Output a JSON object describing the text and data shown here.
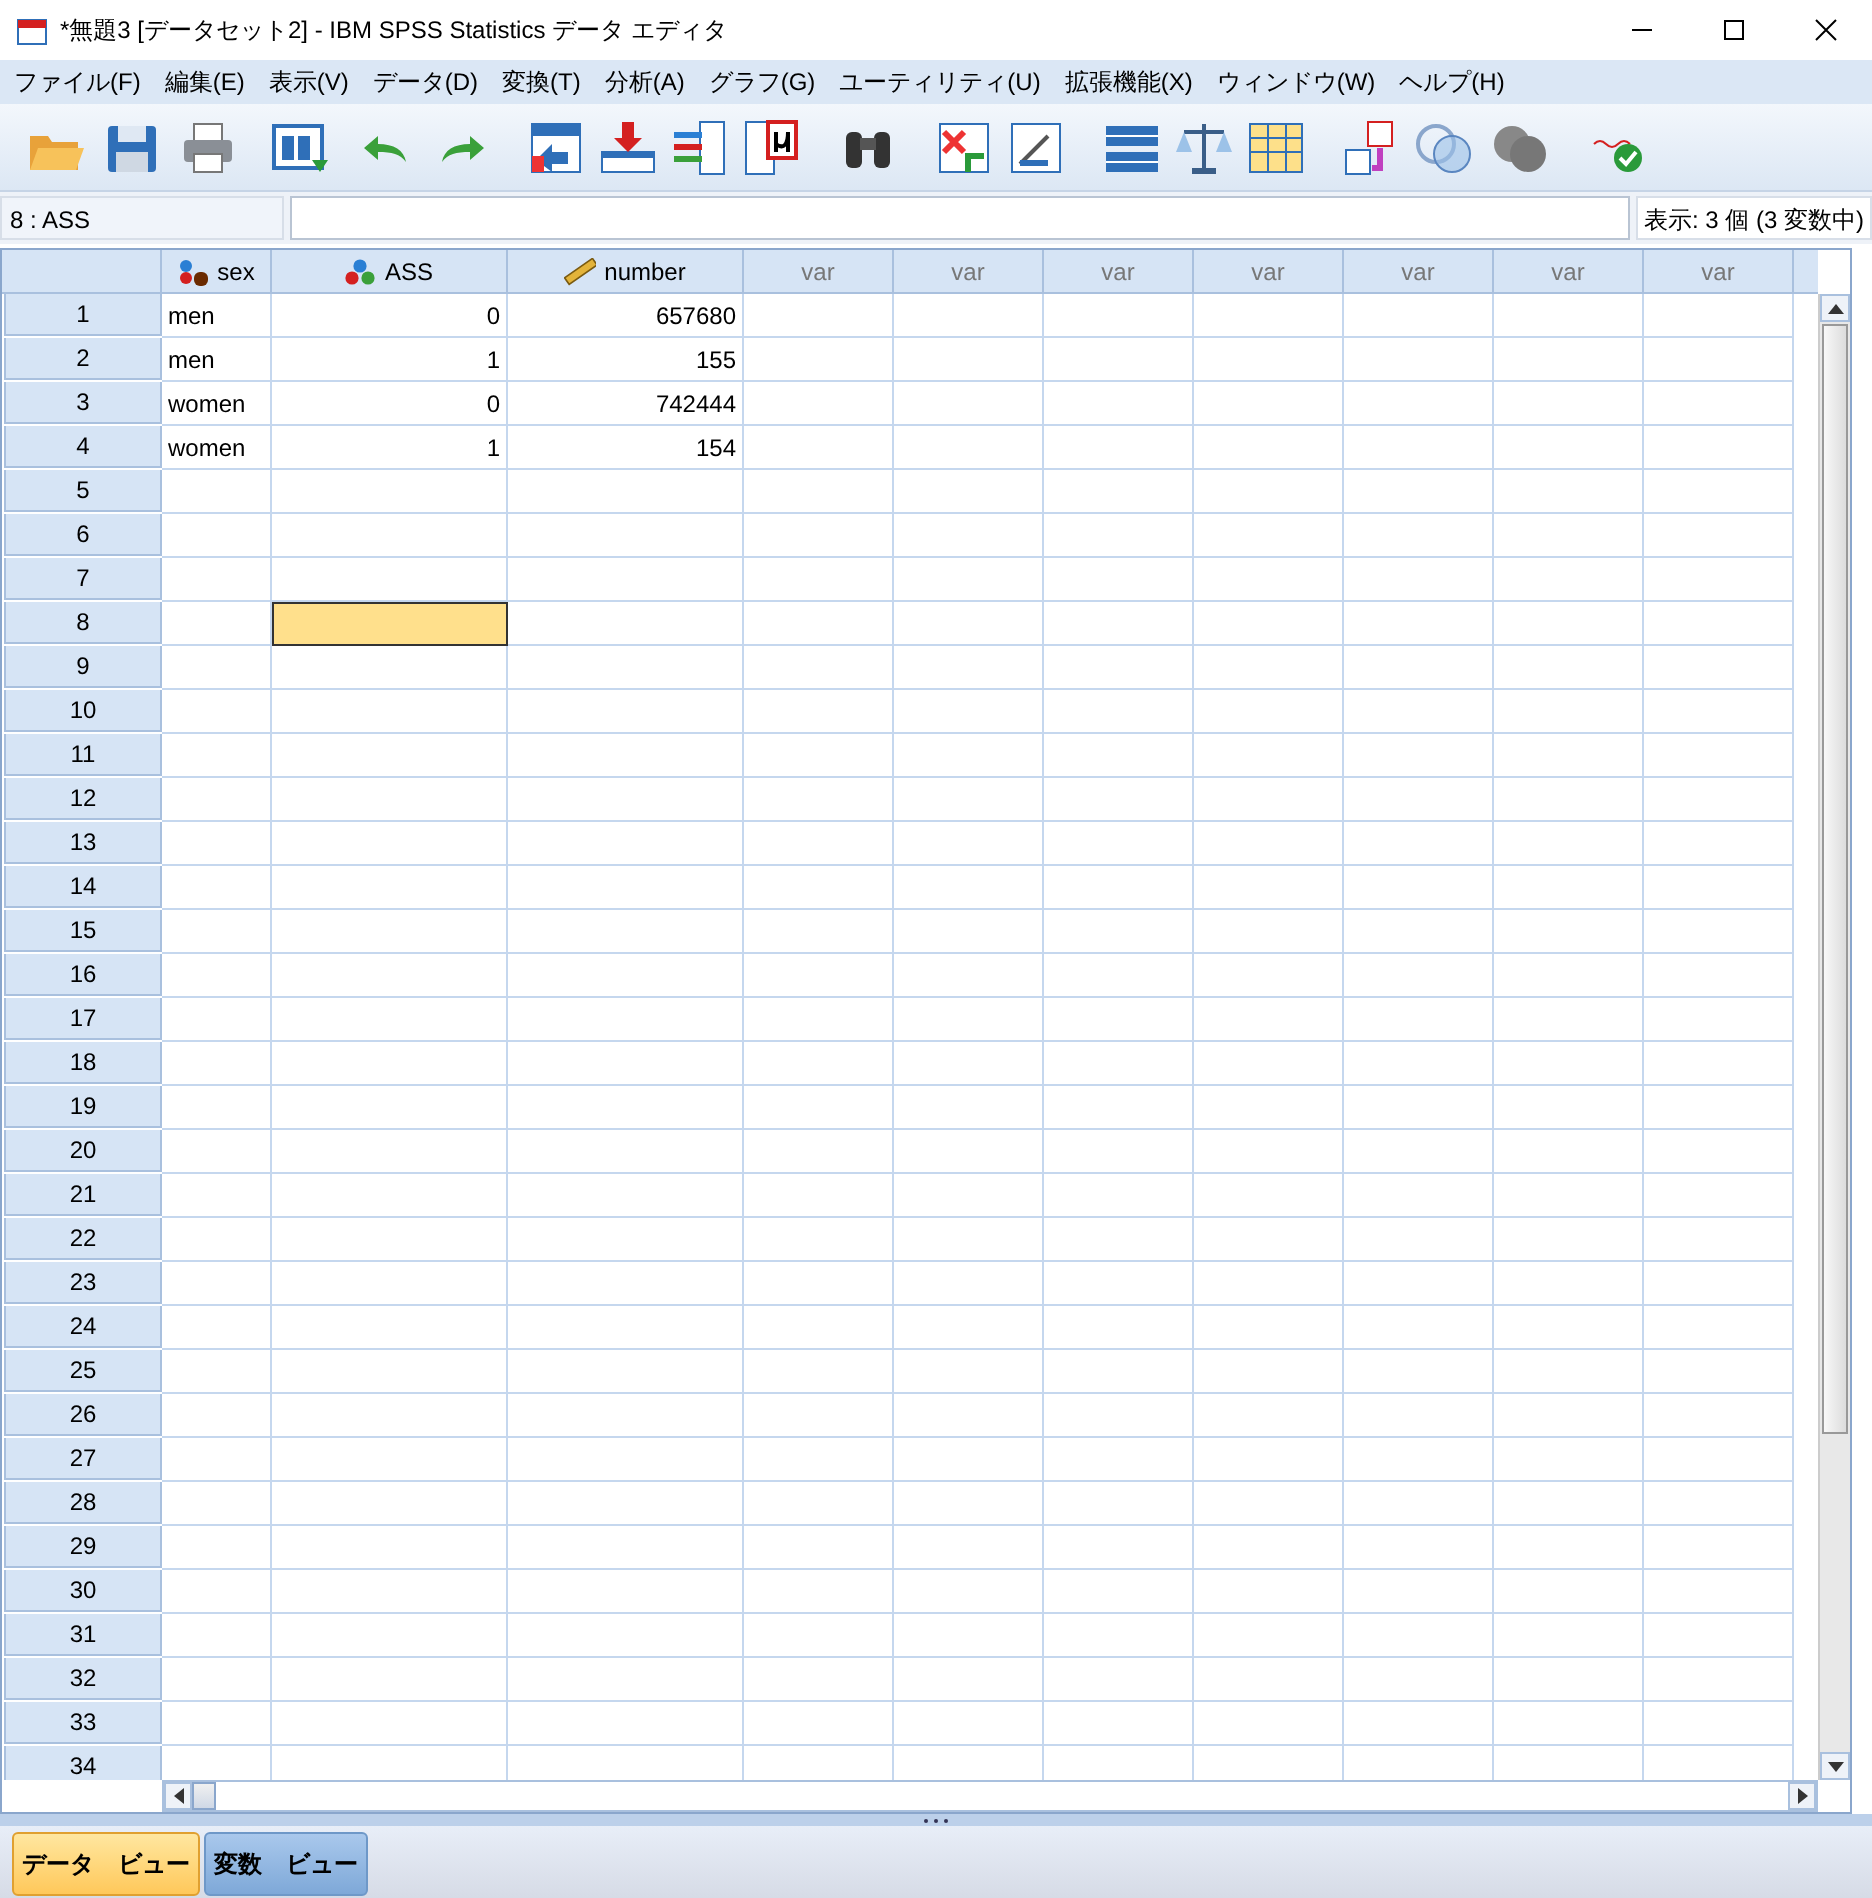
{
  "window": {
    "title": "*無題3 [データセット2] - IBM SPSS Statistics データ エディタ"
  },
  "menu": [
    "ファイル(F)",
    "編集(E)",
    "表示(V)",
    "データ(D)",
    "変換(T)",
    "分析(A)",
    "グラフ(G)",
    "ユーティリティ(U)",
    "拡張機能(X)",
    "ウィンドウ(W)",
    "ヘルプ(H)"
  ],
  "cell_reference": "8 : ASS",
  "visible_count": "表示: 3 個 (3 変数中)",
  "columns": [
    {
      "label": "sex",
      "kind": "string"
    },
    {
      "label": "ASS",
      "kind": "nominal"
    },
    {
      "label": "number",
      "kind": "scale"
    },
    {
      "label": "var",
      "kind": "empty"
    },
    {
      "label": "var",
      "kind": "empty"
    },
    {
      "label": "var",
      "kind": "empty"
    },
    {
      "label": "var",
      "kind": "empty"
    },
    {
      "label": "var",
      "kind": "empty"
    },
    {
      "label": "var",
      "kind": "empty"
    },
    {
      "label": "var",
      "kind": "empty"
    }
  ],
  "rows": [
    {
      "number": "1",
      "cells": [
        {
          "value": "men",
          "selected": false
        },
        {
          "value": "0",
          "selected": false
        },
        {
          "value": "657680",
          "selected": false
        }
      ]
    },
    {
      "number": "2",
      "cells": [
        {
          "value": "men",
          "selected": false
        },
        {
          "value": "1",
          "selected": false
        },
        {
          "value": "155",
          "selected": false
        }
      ]
    },
    {
      "number": "3",
      "cells": [
        {
          "value": "women",
          "selected": false
        },
        {
          "value": "0",
          "selected": false
        },
        {
          "value": "742444",
          "selected": false
        }
      ]
    },
    {
      "number": "4",
      "cells": [
        {
          "value": "women",
          "selected": false
        },
        {
          "value": "1",
          "selected": false
        },
        {
          "value": "154",
          "selected": false
        }
      ]
    },
    {
      "number": "5"
    },
    {
      "number": "6"
    },
    {
      "number": "7"
    },
    {
      "number": "8",
      "cells": [
        {
          "selected": false
        },
        {
          "selected": true
        },
        {
          "selected": false
        }
      ]
    },
    {
      "number": "9"
    },
    {
      "number": "10"
    },
    {
      "number": "11"
    },
    {
      "number": "12"
    },
    {
      "number": "13"
    },
    {
      "number": "14"
    },
    {
      "number": "15"
    },
    {
      "number": "16"
    },
    {
      "number": "17"
    },
    {
      "number": "18"
    },
    {
      "number": "19"
    },
    {
      "number": "20"
    },
    {
      "number": "21"
    },
    {
      "number": "22"
    },
    {
      "number": "23"
    },
    {
      "number": "24"
    },
    {
      "number": "25"
    },
    {
      "number": "26"
    },
    {
      "number": "27"
    },
    {
      "number": "28"
    },
    {
      "number": "29"
    },
    {
      "number": "30"
    },
    {
      "number": "31"
    },
    {
      "number": "32"
    },
    {
      "number": "33"
    },
    {
      "number": "34"
    }
  ],
  "view_tabs": [
    {
      "label": "データ　ビュー",
      "selected": true
    },
    {
      "label": "変数　ビュー",
      "selected": false
    }
  ]
}
